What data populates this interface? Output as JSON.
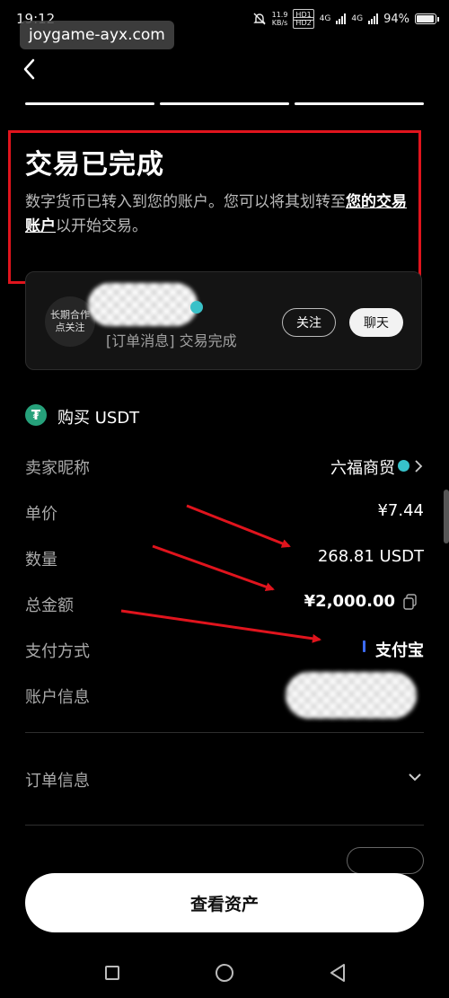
{
  "status_bar": {
    "time": "19:12",
    "net_speed_value": "11.9",
    "net_speed_unit": "KB/s",
    "hd1": "HD1",
    "hd2": "HD2",
    "signal1": "4G",
    "signal2": "4G",
    "battery": "94%"
  },
  "watermark": "joygame-ayx.com",
  "header": {
    "title": "交易已完成",
    "desc_prefix": "数字货币已转入到您的账户。您可以将其划转至",
    "desc_link": "您的交易账户",
    "desc_suffix": "以开始交易。"
  },
  "merchant": {
    "avatar_text_line1": "长期合作",
    "avatar_text_line2": "点关注",
    "order_message": "[订单消息] 交易完成",
    "follow_label": "关注",
    "chat_label": "聊天"
  },
  "order": {
    "icon_symbol": "₮",
    "title": "购买 USDT",
    "rows": [
      {
        "label": "卖家昵称",
        "value": "六福商贸"
      },
      {
        "label": "单价",
        "value": "¥7.44"
      },
      {
        "label": "数量",
        "value": "268.81 USDT"
      },
      {
        "label": "总金额",
        "value": "¥2,000.00"
      },
      {
        "label": "支付方式",
        "value": "支付宝"
      },
      {
        "label": "账户信息",
        "value": ""
      }
    ]
  },
  "order_info": {
    "label": "订单信息"
  },
  "cta": {
    "label": "查看资产"
  },
  "colors": {
    "background": "#000000",
    "annotation_red": "#e0141d",
    "usdt_green": "#26a17b",
    "verify_teal": "#37c1c9",
    "alipay_blue": "#3d6cff"
  }
}
